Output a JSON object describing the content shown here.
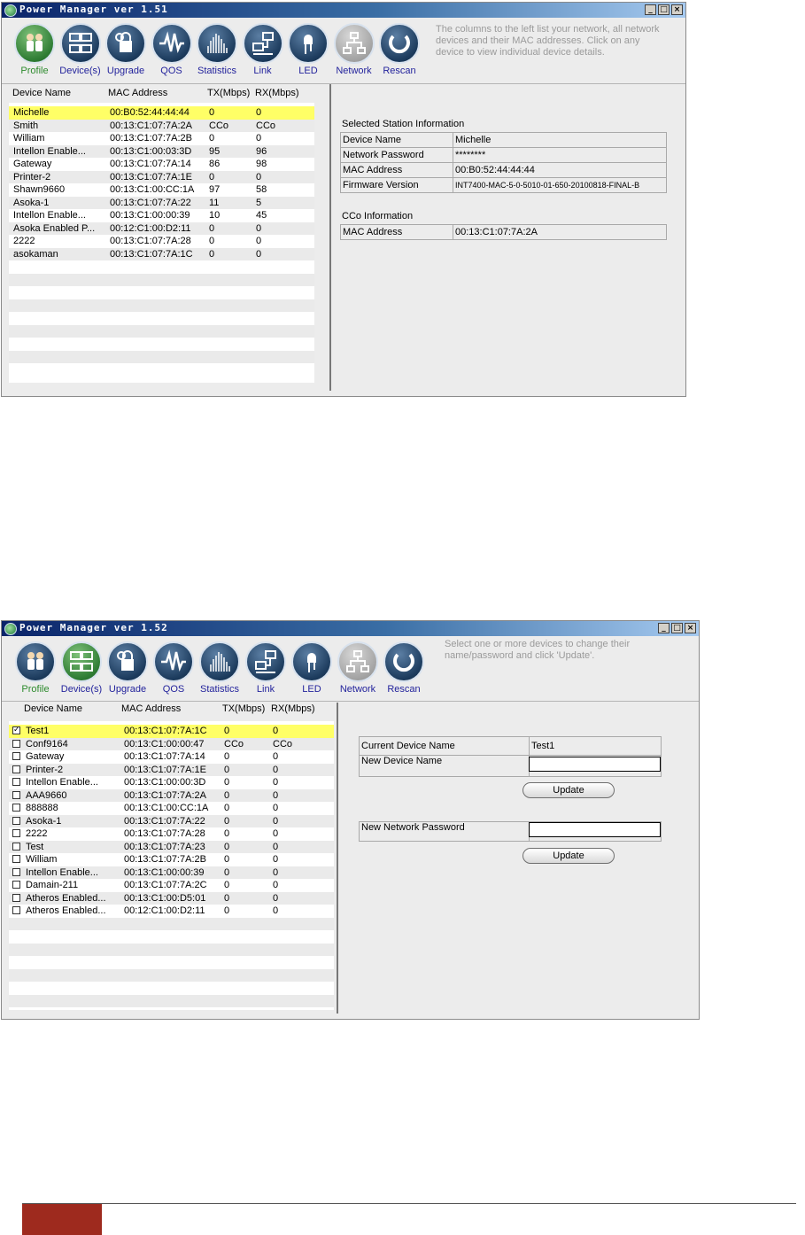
{
  "win1": {
    "title": "Power Manager ver 1.51",
    "info": [
      "The columns to the left list your network, all network",
      "devices and their MAC addresses. Click on any",
      "device to view individual device details."
    ],
    "toolbar": [
      {
        "label": "Profile",
        "icon": "profile-icon"
      },
      {
        "label": "Device(s)",
        "icon": "devices-icon"
      },
      {
        "label": "Upgrade",
        "icon": "upgrade-icon"
      },
      {
        "label": "QOS",
        "icon": "qos-icon"
      },
      {
        "label": "Statistics",
        "icon": "statistics-icon"
      },
      {
        "label": "Link",
        "icon": "link-icon"
      },
      {
        "label": "LED",
        "icon": "led-icon"
      },
      {
        "label": "Network",
        "icon": "network-icon"
      },
      {
        "label": "Rescan",
        "icon": "rescan-icon"
      }
    ],
    "columns": [
      "Device Name",
      "MAC Address",
      "TX(Mbps)",
      "RX(Mbps)"
    ],
    "rows": [
      [
        "Michelle",
        "00:B0:52:44:44:44",
        "0",
        "0"
      ],
      [
        "Smith",
        "00:13:C1:07:7A:2A",
        "CCo",
        "CCo"
      ],
      [
        "William",
        "00:13:C1:07:7A:2B",
        "0",
        "0"
      ],
      [
        "Intellon Enable...",
        "00:13:C1:00:03:3D",
        "95",
        "96"
      ],
      [
        "Gateway",
        "00:13:C1:07:7A:14",
        "86",
        "98"
      ],
      [
        "Printer-2",
        "00:13:C1:07:7A:1E",
        "0",
        "0"
      ],
      [
        "Shawn9660",
        "00:13:C1:00:CC:1A",
        "97",
        "58"
      ],
      [
        "Asoka-1",
        "00:13:C1:07:7A:22",
        "11",
        "5"
      ],
      [
        "Intellon Enable...",
        "00:13:C1:00:00:39",
        "10",
        "45"
      ],
      [
        "Asoka Enabled P...",
        "00:12:C1:00:D2:11",
        "0",
        "0"
      ],
      [
        "2222",
        "00:13:C1:07:7A:28",
        "0",
        "0"
      ],
      [
        "asokaman",
        "00:13:C1:07:7A:1C",
        "0",
        "0"
      ]
    ],
    "station_title": "Selected Station Information",
    "station": [
      [
        "Device Name",
        "Michelle"
      ],
      [
        "Network Password",
        "********"
      ],
      [
        "MAC Address",
        "00:B0:52:44:44:44"
      ],
      [
        "Firmware Version",
        "INT7400-MAC-5-0-5010-01-650-20100818-FINAL-B"
      ]
    ],
    "cco_title": "CCo Information",
    "cco": [
      [
        "MAC Address",
        "00:13:C1:07:7A:2A"
      ]
    ]
  },
  "win2": {
    "title": "Power Manager ver 1.52",
    "info": [
      "Select one or more devices to change their",
      "name/password and click 'Update'."
    ],
    "toolbar": [
      {
        "label": "Profile",
        "icon": "profile-icon"
      },
      {
        "label": "Device(s)",
        "icon": "devices-icon"
      },
      {
        "label": "Upgrade",
        "icon": "upgrade-icon"
      },
      {
        "label": "QOS",
        "icon": "qos-icon"
      },
      {
        "label": "Statistics",
        "icon": "statistics-icon"
      },
      {
        "label": "Link",
        "icon": "link-icon"
      },
      {
        "label": "LED",
        "icon": "led-icon"
      },
      {
        "label": "Network",
        "icon": "network-icon"
      },
      {
        "label": "Rescan",
        "icon": "rescan-icon"
      }
    ],
    "columns": [
      "Device Name",
      "MAC Address",
      "TX(Mbps)",
      "RX(Mbps)"
    ],
    "rows": [
      [
        "Test1",
        "00:13:C1:07:7A:1C",
        "0",
        "0",
        true
      ],
      [
        "Conf9164",
        "00:13:C1:00:00:47",
        "CCo",
        "CCo",
        false
      ],
      [
        "Gateway",
        "00:13:C1:07:7A:14",
        "0",
        "0",
        false
      ],
      [
        "Printer-2",
        "00:13:C1:07:7A:1E",
        "0",
        "0",
        false
      ],
      [
        "Intellon Enable...",
        "00:13:C1:00:00:3D",
        "0",
        "0",
        false
      ],
      [
        "AAA9660",
        "00:13:C1:07:7A:2A",
        "0",
        "0",
        false
      ],
      [
        "888888",
        "00:13:C1:00:CC:1A",
        "0",
        "0",
        false
      ],
      [
        "Asoka-1",
        "00:13:C1:07:7A:22",
        "0",
        "0",
        false
      ],
      [
        "2222",
        "00:13:C1:07:7A:28",
        "0",
        "0",
        false
      ],
      [
        "Test",
        "00:13:C1:07:7A:23",
        "0",
        "0",
        false
      ],
      [
        "William",
        "00:13:C1:07:7A:2B",
        "0",
        "0",
        false
      ],
      [
        "Intellon Enable...",
        "00:13:C1:00:00:39",
        "0",
        "0",
        false
      ],
      [
        "Damain-211",
        "00:13:C1:07:7A:2C",
        "0",
        "0",
        false
      ],
      [
        "Atheros Enabled...",
        "00:13:C1:00:D5:01",
        "0",
        "0",
        false
      ],
      [
        "Atheros Enabled...",
        "00:12:C1:00:D2:11",
        "0",
        "0",
        false
      ]
    ],
    "current_label": "Current Device Name",
    "current_value": "Test1",
    "new_name_label": "New Device Name",
    "new_name_value": "",
    "new_pw_label": "New Network Password",
    "new_pw_value": "",
    "update_label": "Update"
  },
  "colors": {
    "selected_row": "#ffff66",
    "active_tab": "#2e8b2e",
    "tab_label": "#23239c",
    "footer_block": "#9e2a1e"
  }
}
